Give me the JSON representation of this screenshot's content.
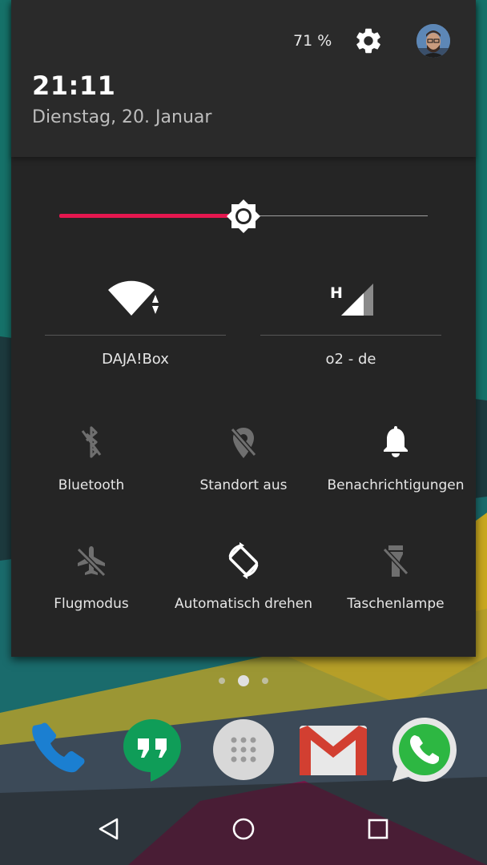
{
  "status": {
    "battery_text": "71 %",
    "settings_icon": "gear-icon",
    "avatar_icon": "user-avatar"
  },
  "header": {
    "time": "21:11",
    "date": "Dienstag, 20. Januar"
  },
  "brightness": {
    "level": 0.5,
    "active_color": "#e5174f",
    "icon": "brightness-icon"
  },
  "big_tiles": [
    {
      "label": "DAJA!Box",
      "icon": "wifi-icon"
    },
    {
      "label": "o2 - de",
      "icon": "cellular-signal-icon",
      "network_type": "H"
    }
  ],
  "tiles": [
    {
      "label": "Bluetooth",
      "icon": "bluetooth-off-icon",
      "active": false
    },
    {
      "label": "Standort aus",
      "icon": "location-off-icon",
      "active": false
    },
    {
      "label": "Benachrichtigungen",
      "icon": "bell-icon",
      "active": true
    },
    {
      "label": "Flugmodus",
      "icon": "airplane-off-icon",
      "active": false
    },
    {
      "label": "Automatisch drehen",
      "icon": "auto-rotate-icon",
      "active": true
    },
    {
      "label": "Taschenlampe",
      "icon": "flashlight-off-icon",
      "active": false
    }
  ],
  "home": {
    "page_count": 3,
    "current_page": 2,
    "dock": [
      "phone-icon",
      "hangouts-icon",
      "app-drawer-icon",
      "gmail-icon",
      "whatsapp-icon"
    ]
  },
  "navbar": [
    "back-icon",
    "home-icon",
    "recents-icon"
  ],
  "colors": {
    "panel": "#252525",
    "header": "#2a2a2a",
    "accent": "#e5174f",
    "inactive_icon": "#6f6f6f",
    "active_icon": "#ffffff"
  }
}
